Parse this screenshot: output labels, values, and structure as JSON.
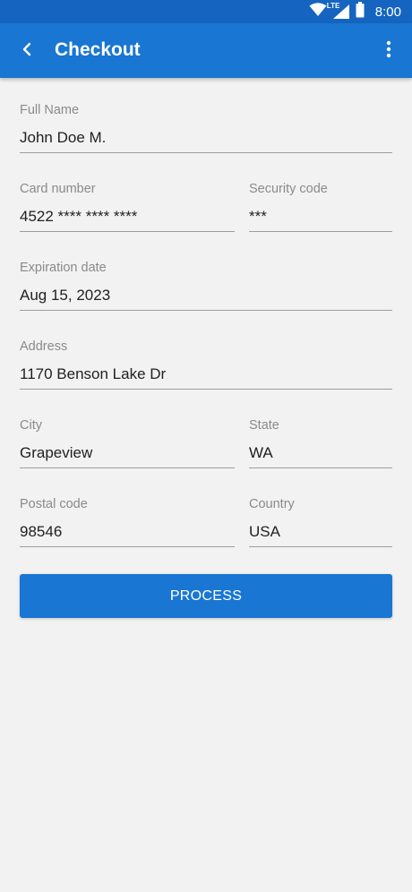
{
  "status_bar": {
    "time": "8:00",
    "network_label": "LTE",
    "icons": [
      "wifi-icon",
      "signal-icon",
      "battery-icon"
    ]
  },
  "app_bar": {
    "title": "Checkout",
    "back_icon": "back-arrow-icon",
    "menu_icon": "more-vert-icon"
  },
  "form": {
    "full_name": {
      "label": "Full Name",
      "value": "John Doe M."
    },
    "card_number": {
      "label": "Card number",
      "value": "4522 **** **** ****"
    },
    "security_code": {
      "label": "Security code",
      "value": "***"
    },
    "expiration_date": {
      "label": "Expiration date",
      "value": "Aug 15, 2023"
    },
    "address": {
      "label": "Address",
      "value": "1170 Benson Lake Dr"
    },
    "city": {
      "label": "City",
      "value": "Grapeview"
    },
    "state": {
      "label": "State",
      "value": "WA"
    },
    "postal_code": {
      "label": "Postal code",
      "value": "98546"
    },
    "country": {
      "label": "Country",
      "value": "USA"
    }
  },
  "process_button": {
    "label": "PROCESS"
  },
  "colors": {
    "primary": "#1976d2",
    "primary_dark": "#1565c0",
    "background": "#f2f2f2",
    "label": "#8a8a8a"
  }
}
